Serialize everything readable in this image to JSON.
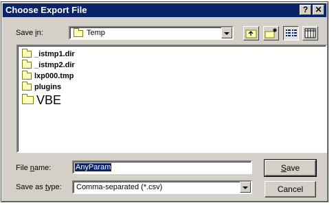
{
  "window": {
    "title": "Choose Export File"
  },
  "title_buttons": {
    "help": "?",
    "close": "✕"
  },
  "save_in": {
    "label_pre": "Save ",
    "label_key": "i",
    "label_post": "n:",
    "value": "Temp"
  },
  "files": [
    {
      "name": "_istmp1.dir",
      "icon": "folder-icon"
    },
    {
      "name": "_istmp2.dir",
      "icon": "folder-icon"
    },
    {
      "name": "lxp000.tmp",
      "icon": "folder-icon"
    },
    {
      "name": "plugins",
      "icon": "folder-icon"
    },
    {
      "name": "VBE",
      "icon": "folder-icon"
    }
  ],
  "file_name": {
    "label_pre": "File ",
    "label_key": "n",
    "label_post": "ame:",
    "value": "AnyParam"
  },
  "save_as_type": {
    "label_pre": "Save as ",
    "label_key": "t",
    "label_post": "ype:",
    "value": "Comma-separated (*.csv)"
  },
  "buttons": {
    "save_key": "S",
    "save_rest": "ave",
    "cancel": "Cancel"
  },
  "colors": {
    "titlebar": "#0a246a",
    "face": "#d4d0c8",
    "selection": "#0a246a",
    "folder": "#ffffc0"
  }
}
